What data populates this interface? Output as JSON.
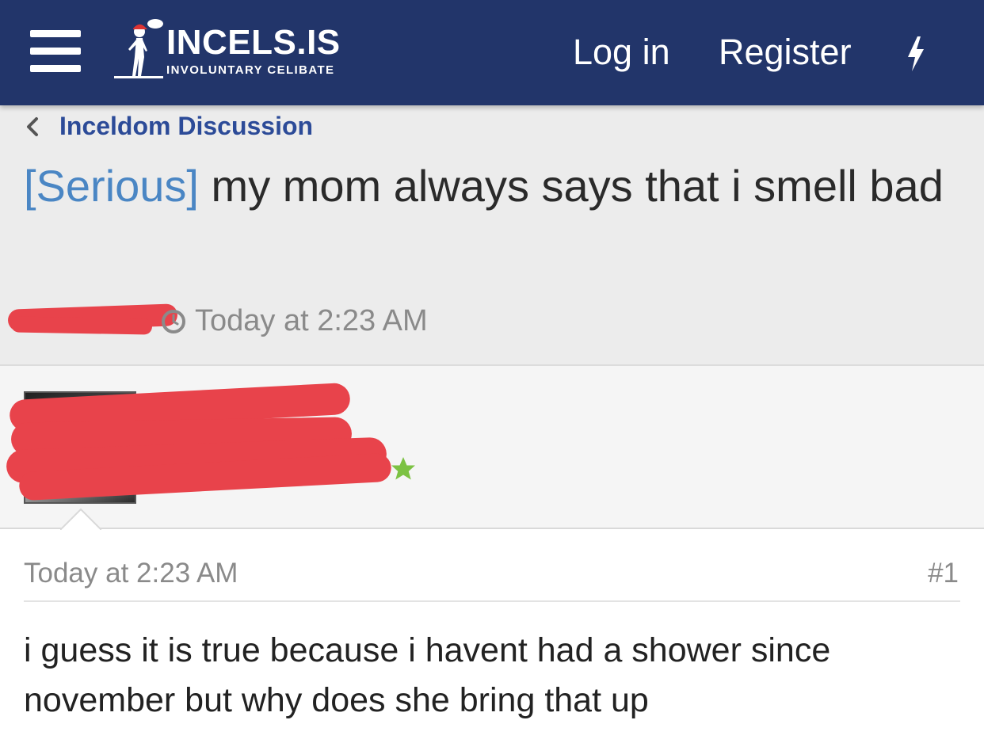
{
  "header": {
    "logo_title": "INCELS.IS",
    "logo_subtitle": "INVOLUNTARY CELIBATE",
    "login_label": "Log in",
    "register_label": "Register",
    "menu_icon": "hamburger-menu-icon",
    "bolt_icon": "lightning-bolt-icon"
  },
  "breadcrumb": {
    "label": "Inceldom Discussion",
    "icon": "chevron-left-icon"
  },
  "thread": {
    "prefix": "[Serious]",
    "title": " my mom always says that i smell bad",
    "time": "Today at 2:23 AM",
    "clock_icon": "clock-icon"
  },
  "post": {
    "time": "Today at 2:23 AM",
    "number": "#1",
    "body": "i guess it is true because i havent had a shower since november but why does she bring that up"
  },
  "colors": {
    "header_bg": "#22356a",
    "link": "#2c4b98",
    "prefix": "#4a86c4",
    "redaction": "#e8434b",
    "star": "#7cc243"
  }
}
